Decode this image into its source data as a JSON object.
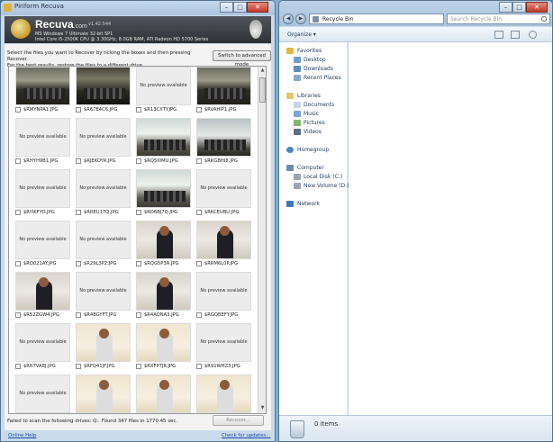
{
  "recuva": {
    "title": "Piriform Recuva",
    "brand": "Recuva",
    "brand_suffix": ".com",
    "version": "v1.42.544",
    "os_info": "MS Windows 7 Ultimate 32-bit SP1",
    "hw_info": "Intel Core i5-2500K CPU @ 3.30GHz, 8.0GB RAM, ATI Radeon HD 5700 Series",
    "instructions_line1": "Select the files you want to Recover by ticking the boxes and then pressing Recover.",
    "instructions_line2": "For the best results, restore the files to a different drive.",
    "advanced_button": "Switch to advanced mode",
    "no_preview_text": "No preview available",
    "files": [
      {
        "name": "$RMYNPA1.JPG",
        "thumb": "hall"
      },
      {
        "name": "$R67E4C6.JPG",
        "thumb": "hall2"
      },
      {
        "name": "$R13CXTY.JPG",
        "thumb": "none"
      },
      {
        "name": "$RVAHIP1.JPG",
        "thumb": "hall"
      },
      {
        "name": "$RHYH9B1.JPG",
        "thumb": "none"
      },
      {
        "name": "$RJEKOYR.JPG",
        "thumb": "none"
      },
      {
        "name": "$RQ5I0MU.JPG",
        "thumb": "outdoor"
      },
      {
        "name": "$RKGBHI8.JPG",
        "thumb": "outdoor2"
      },
      {
        "name": "$RYIKFYO.JPG",
        "thumb": "none"
      },
      {
        "name": "$RREU17Q.JPG",
        "thumb": "none"
      },
      {
        "name": "$RD6BJ7Q.JPG",
        "thumb": "outdoor"
      },
      {
        "name": "$RKCEUBU.JPG",
        "thumb": "none"
      },
      {
        "name": "$RQ021AY.JPG",
        "thumb": "none"
      },
      {
        "name": "$R29L3P2.JPG",
        "thumb": "none"
      },
      {
        "name": "$RQG5P3A.JPG",
        "thumb": "portrait"
      },
      {
        "name": "$RRM6L0P.JPG",
        "thumb": "portrait"
      },
      {
        "name": "$R52ZGW4.JPG",
        "thumb": "portrait"
      },
      {
        "name": "$R4BGYFT.JPG",
        "thumb": "none"
      },
      {
        "name": "$R4AQNA3.JPG",
        "thumb": "portrait"
      },
      {
        "name": "$RGQBEFY.JPG",
        "thumb": "none"
      },
      {
        "name": "$RR7VA8J.JPG",
        "thumb": "none"
      },
      {
        "name": "$RFQ41JF.JPG",
        "thumb": "beige"
      },
      {
        "name": "$RXFP7JR.JPG",
        "thumb": "beige"
      },
      {
        "name": "$R91WHZ3.JPG",
        "thumb": "none"
      },
      {
        "name": "",
        "thumb": "none"
      },
      {
        "name": "",
        "thumb": "beige"
      },
      {
        "name": "",
        "thumb": "beige"
      },
      {
        "name": "",
        "thumb": "beige"
      }
    ],
    "status": "Failed to scan the following drives: Q:.  Found 347 files in 1770.45 sec.",
    "recover_button": "Recover...",
    "online_help": "Online Help",
    "check_updates": "Check for updates..."
  },
  "explorer": {
    "address": "Recycle Bin",
    "search_placeholder": "Search Recycle Bin",
    "organize": "Organize",
    "favorites_header": "Favorites",
    "favorites": [
      "Desktop",
      "Downloads",
      "Recent Places"
    ],
    "libraries_header": "Libraries",
    "libraries": [
      "Documents",
      "Music",
      "Pictures",
      "Videos"
    ],
    "homegroup": "Homegroup",
    "computer_header": "Computer",
    "drives": [
      "Local Disk (C:)",
      "New Volume (D:)"
    ],
    "network": "Network",
    "items_count": "0 items"
  },
  "colors": {
    "accent": "#1e395b",
    "link": "#1c4aa8",
    "window_frame": "#c9dbea"
  }
}
